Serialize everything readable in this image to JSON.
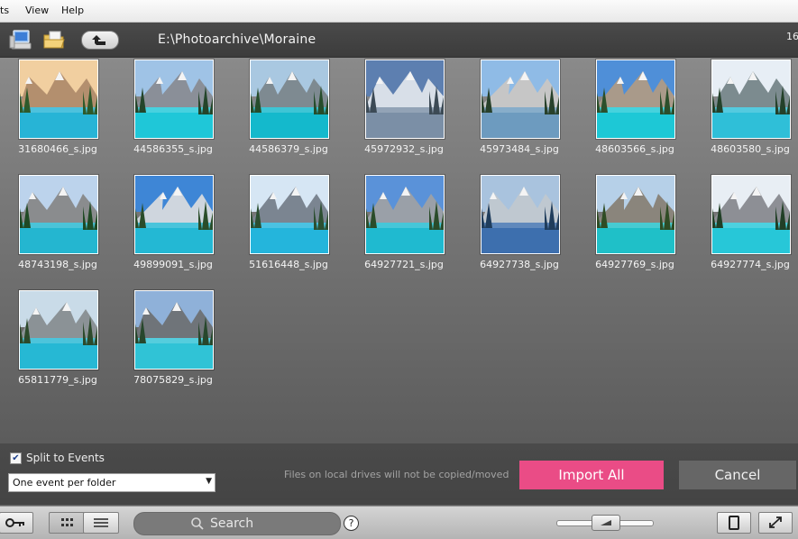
{
  "menu": {
    "items": [
      "ts",
      "View",
      "Help"
    ]
  },
  "toolbar": {
    "path": "E:\\Photoarchive\\Moraine",
    "count": "16"
  },
  "photos": [
    {
      "name": "31680466_s.jpg",
      "sky": "#f1cfa0",
      "mount": "#b38f6e",
      "water": "#27b4d6",
      "tree": "#2e5a2b"
    },
    {
      "name": "44586355_s.jpg",
      "sky": "#9fc3e6",
      "mount": "#8a8f98",
      "water": "#1fc7d8",
      "tree": "#24452a"
    },
    {
      "name": "44586379_s.jpg",
      "sky": "#a9c8e1",
      "mount": "#7e8a91",
      "water": "#14b9cc",
      "tree": "#264d2b"
    },
    {
      "name": "45972932_s.jpg",
      "sky": "#5d7fb0",
      "mount": "#d8dfe8",
      "water": "#7b8fa6",
      "tree": "#3c4a55"
    },
    {
      "name": "45973484_s.jpg",
      "sky": "#8fbbe6",
      "mount": "#c6c6c6",
      "water": "#6d9bbf",
      "tree": "#28412b"
    },
    {
      "name": "48603566_s.jpg",
      "sky": "#4f8fd8",
      "mount": "#a99a8a",
      "water": "#1dc8d6",
      "tree": "#2b4f2b"
    },
    {
      "name": "48603580_s.jpg",
      "sky": "#e7eef5",
      "mount": "#7c8b8f",
      "water": "#2fbfd8",
      "tree": "#24412a"
    },
    {
      "name": "48743198_s.jpg",
      "sky": "#bcd3ec",
      "mount": "#8a8c8e",
      "water": "#24b6d0",
      "tree": "#1f4a24"
    },
    {
      "name": "49899091_s.jpg",
      "sky": "#3e86d6",
      "mount": "#cfd6de",
      "water": "#23b8d4",
      "tree": "#2a4d2a"
    },
    {
      "name": "51616448_s.jpg",
      "sky": "#d6e6f4",
      "mount": "#7b8591",
      "water": "#24b5dc",
      "tree": "#2c4f31"
    },
    {
      "name": "64927721_s.jpg",
      "sky": "#5a92d9",
      "mount": "#9aa0a8",
      "water": "#1fbad0",
      "tree": "#2a4c2a"
    },
    {
      "name": "64927738_s.jpg",
      "sky": "#a9c3de",
      "mount": "#bfc8d0",
      "water": "#3d6fae",
      "tree": "#1f3d5c"
    },
    {
      "name": "64927769_s.jpg",
      "sky": "#b6d0e8",
      "mount": "#8a857c",
      "water": "#1fc0c8",
      "tree": "#2f4c24"
    },
    {
      "name": "64927774_s.jpg",
      "sky": "#e8eef4",
      "mount": "#8d8f95",
      "water": "#27c7d8",
      "tree": "#213f26"
    },
    {
      "name": "65811779_s.jpg",
      "sky": "#c9dbe8",
      "mount": "#8b9296",
      "water": "#26b8d4",
      "tree": "#2c4a2b"
    },
    {
      "name": "78075829_s.jpg",
      "sky": "#8fb1d9",
      "mount": "#6f7479",
      "water": "#30c3d6",
      "tree": "#27472c"
    }
  ],
  "bottom": {
    "split_label": "Split to Events",
    "split_checked": true,
    "event_option": "One event per folder",
    "note": "Files on local drives will not be copied/moved",
    "import_label": "Import All",
    "cancel_label": "Cancel"
  },
  "statusbar": {
    "search_placeholder": "Search",
    "help": "?"
  },
  "colors": {
    "accent": "#ea4c86",
    "cancel": "#666666",
    "panel": "#3e3e3e"
  }
}
